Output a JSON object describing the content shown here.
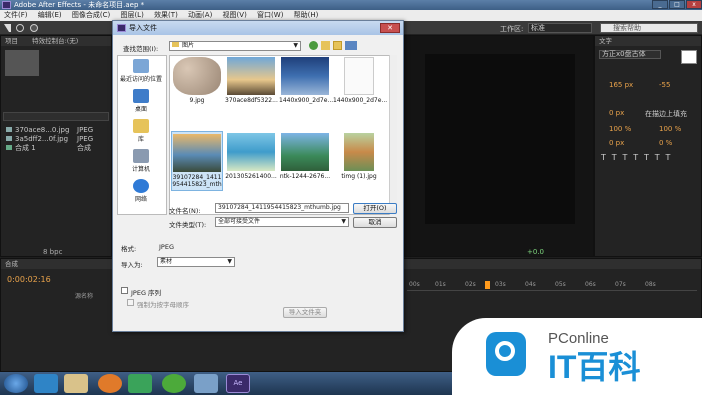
{
  "window": {
    "title": "Adobe After Effects - 未命名项目.aep *",
    "menu": [
      "文件(F)",
      "编辑(E)",
      "图像合成(C)",
      "图层(L)",
      "效果(T)",
      "动画(A)",
      "视图(V)",
      "窗口(W)",
      "帮助(H)"
    ]
  },
  "toolbar": {
    "workspace_label": "工作区:",
    "workspace_value": "标准",
    "search_placeholder": "搜索帮助"
  },
  "project_panel": {
    "tab": "项目",
    "tab2": "特效控制台:(无)",
    "items": [
      {
        "name": "370ace8...0.jpg",
        "type": "JPEG"
      },
      {
        "name": "3a5dff2...0f.jpg",
        "type": "JPEG"
      },
      {
        "name": "合成 1",
        "type": "合成"
      }
    ],
    "bpc": "8 bpc"
  },
  "right_panel": {
    "tab": "文字",
    "font": "方正x0盘古体",
    "size1": "165 px",
    "size2": "-55",
    "px": "0 px",
    "stroke": "在描边上填充",
    "pct1": "100 %",
    "pct2": "100 %",
    "px2": "0 px",
    "pct3": "0 %"
  },
  "timeline": {
    "tab": "合成",
    "timecode": "0:00:02:16",
    "source_col": "源名称",
    "ticks": [
      "00s",
      "01s",
      "02s",
      "03s",
      "04s",
      "05s",
      "06s",
      "07s",
      "08s"
    ],
    "viewer_value": "+0.0"
  },
  "dialog": {
    "title": "导入文件",
    "close": "✕",
    "lookin_label": "查找范围(I):",
    "lookin_value": "图片",
    "sidebar": [
      "最近访问的位置",
      "桌面",
      "库",
      "计算机",
      "网络"
    ],
    "files": [
      "9.jpg",
      "370ace8df5322...",
      "1440x900_2d7e...",
      "1440x900_2d7e...",
      "39107284_1411954415823_mthumb.jpg",
      "201305261400...",
      "ntk-1244-2676...",
      "timg (1).jpg"
    ],
    "filename_label": "文件名(N):",
    "filename_value": "39107284_1411954415823_mthumb.jpg",
    "filetype_label": "文件类型(T):",
    "filetype_value": "全部可接受文件",
    "open_btn": "打开(O)",
    "cancel_btn": "取消",
    "format_label": "格式:",
    "format_value": "JPEG",
    "importas_label": "导入为:",
    "importas_value": "素材",
    "seq_label": "JPEG 序列",
    "alpha_label": "强制为按字母顺序",
    "import_folder_btn": "导入文件夹"
  },
  "watermark": {
    "brand": "PConline",
    "text": "IT百科"
  },
  "colors": {
    "ae_bg": "#1e1e1e",
    "dialog_bg": "#f0f0f0",
    "accent": "#1a8fd6",
    "playhead": "#ff9a1c"
  }
}
